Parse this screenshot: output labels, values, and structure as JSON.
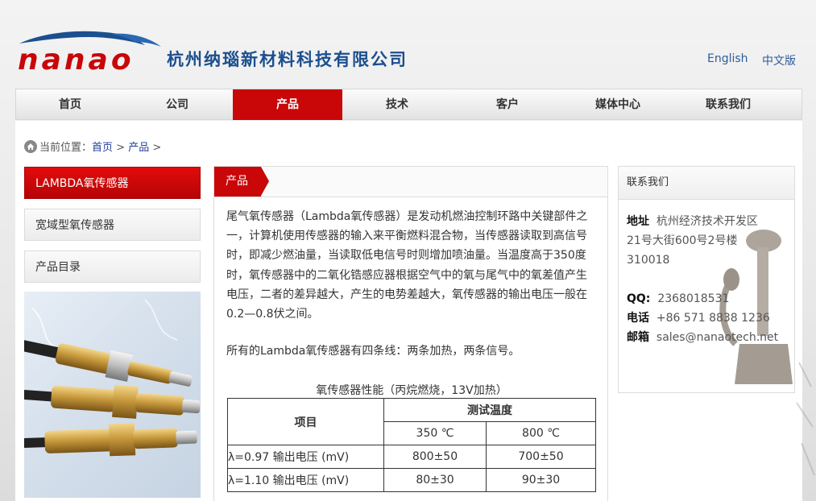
{
  "header": {
    "logo_text": "nanao",
    "company_name": "杭州纳瑙新材料科技有限公司",
    "lang_english": "English",
    "lang_chinese": "中文版"
  },
  "nav": {
    "items": [
      {
        "label": "首页"
      },
      {
        "label": "公司"
      },
      {
        "label": "产品",
        "active": true
      },
      {
        "label": "技术"
      },
      {
        "label": "客户"
      },
      {
        "label": "媒体中心"
      },
      {
        "label": "联系我们"
      }
    ]
  },
  "breadcrumb": {
    "prefix": "当前位置：",
    "home": "首页",
    "sep1": " > ",
    "current": "产品",
    "sep2": " >"
  },
  "sidebar": {
    "items": [
      {
        "label": "LAMBDA氧传感器",
        "active": true
      },
      {
        "label": "宽域型氧传感器"
      },
      {
        "label": "产品目录"
      }
    ]
  },
  "main": {
    "tab_label": "产品",
    "paragraph1": "尾气氧传感器（Lambda氧传感器）是发动机燃油控制环路中关键部件之一，计算机使用传感器的输入来平衡燃料混合物，当传感器读取到高信号时，即减少燃油量，当读取低电信号时则增加喷油量。当温度高于350度时，氧传感器中的二氧化锆感应器根据空气中的氧与尾气中的氧差值产生电压，二者的差异越大，产生的电势差越大，氧传感器的输出电压一般在0.2—0.8伏之间。",
    "paragraph2": "所有的Lambda氧传感器有四条线：两条加热，两条信号。",
    "table_caption": "氧传感器性能（丙烷燃烧，13V加热）",
    "table": {
      "col_item": "项目",
      "col_test_temp": "测试温度",
      "temp1": "350 ℃",
      "temp2": "800 ℃",
      "rows": [
        {
          "item": "λ=0.97  输出电压 (mV)",
          "v1": "800±50",
          "v2": "700±50"
        },
        {
          "item": "λ=1.10  输出电压 (mV)",
          "v1": "80±30",
          "v2": "90±30"
        }
      ]
    }
  },
  "contact": {
    "title": "联系我们",
    "address_label": "地址",
    "address_line1": "杭州经济技术开发区",
    "address_line2": "21号大街600号2号楼",
    "address_line3": "310018",
    "qq_label": "QQ:",
    "qq": "2368018531",
    "phone_label": "电话",
    "phone": "+86 571 8838 1236",
    "email_label": "邮箱",
    "email": "sales@nanaotech.net"
  },
  "colors": {
    "brand_red": "#c90608",
    "brand_blue": "#1b4f8f",
    "link_blue": "#1d3f9c"
  }
}
